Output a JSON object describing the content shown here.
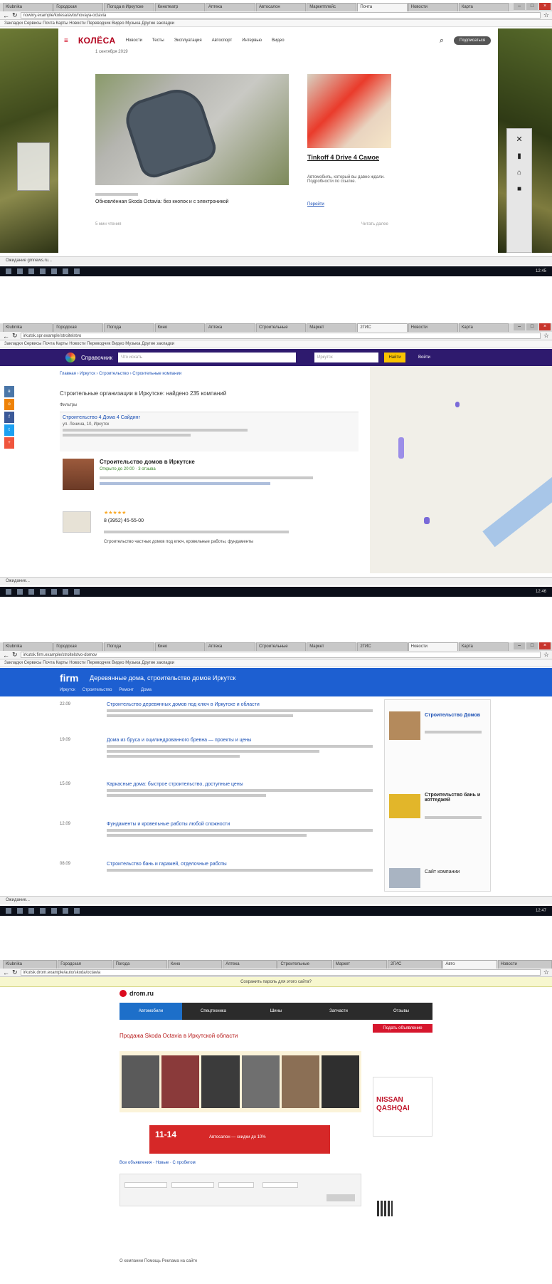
{
  "shots": [
    {
      "browser": {
        "tabs": [
          "Klubnika",
          "Городская",
          "Погода в Иркутске",
          "Кинотеатр",
          "Аптека",
          "Автосалон",
          "Маркетплейс",
          "Почта",
          "Новости",
          "Карта"
        ],
        "active_tab": 7,
        "url": "nowiny.example/kolesa/avto/novaya-octavia",
        "bookmarks": "Закладки   Сервисы   Почта   Карты   Новости   Переводчик   Видео   Музыка   Другие закладки"
      },
      "site": {
        "logo": "КОЛЁСА",
        "nav": [
          "Новости",
          "Тесты",
          "Эксплуатация",
          "Автоспорт",
          "Интервью",
          "Видео"
        ],
        "cta": "Подписаться",
        "date": "1 сентября 2019",
        "headline": "Обновлённая Skoda Octavia: без кнопок и с электроникой",
        "ad_title": "Tinkoff 4 Drive 4 Самое",
        "ad_text": "Автомобиль, который вы давно ждали. Подробности по ссылке.",
        "ad_link": "Перейти",
        "footer_left": "5 мин чтения",
        "footer_right": "Читать далее"
      },
      "rail_icons": [
        "vk-icon",
        "ok-icon",
        "fb-icon",
        "twitter-icon",
        "share-icon"
      ],
      "status": "Ожидание gmnews.ru...",
      "taskbar_time": "12:45"
    },
    {
      "browser": {
        "tabs": [
          "Klubnika",
          "Городская",
          "Погода",
          "Кино",
          "Аптека",
          "Строительные",
          "Маркет",
          "2ГИС",
          "Новости",
          "Карта"
        ],
        "active_tab": 7,
        "url": "irkutsk.spr.example/stroitelstvo",
        "bookmarks": "Закладки   Сервисы   Почта   Карты   Новости   Переводчик   Видео   Музыка   Другие закладки"
      },
      "site": {
        "logo": "Справочник",
        "search_placeholder": "Что искать",
        "city": "Иркутск",
        "search_button": "Найти",
        "login": "Войти",
        "breadcrumb": "Главная › Иркутск › Строительство › Строительные компании",
        "heading": "Строительные организации в Иркутске: найдено 235 компаний",
        "filters": "Фильтры",
        "card1_name": "Строительство 4 Дома 4 Сайдинг",
        "card1_addr": "ул. Ленина, 10, Иркутск",
        "card2_name": "Строительство домов в Иркутске",
        "card2_meta": "Открыто до 20:00 · 3 отзыва",
        "card3_rating": "★★★★★",
        "card3_phone": "8 (3952) 45-55-00",
        "card3_desc": "Строительство частных домов под ключ, кровельные работы, фундаменты"
      },
      "status": "Ожидание...",
      "taskbar_time": "12:46"
    },
    {
      "browser": {
        "tabs": [
          "Klubnika",
          "Городская",
          "Погода",
          "Кино",
          "Аптека",
          "Строительные",
          "Маркет",
          "2ГИС",
          "Новости",
          "Карта"
        ],
        "active_tab": 8,
        "url": "irkutsk.firm.example/stroitelstvo-domov",
        "bookmarks": "Закладки   Сервисы   Почта   Карты   Новости   Переводчик   Видео   Музыка   Другие закладки"
      },
      "site": {
        "logo": "firm",
        "title": "Деревянные дома, строительство домов Иркутск",
        "tabs": [
          "Иркутск",
          "Строительство",
          "Ремонт",
          "Дома"
        ],
        "entries": [
          {
            "date": "22.09",
            "title": "Строительство деревянных домов под ключ в Иркутске и области"
          },
          {
            "date": "19.09",
            "title": "Дома из бруса и оцилиндрованного бревна — проекты и цены"
          },
          {
            "date": "15.09",
            "title": "Каркасные дома: быстрое строительство, доступные цены"
          },
          {
            "date": "12.09",
            "title": "Фундаменты и кровельные работы любой сложности"
          },
          {
            "date": "08.09",
            "title": "Строительство бань и гаражей, отделочные работы"
          }
        ],
        "side_title1": "Строительство Домов",
        "side_title2": "Строительство бань и коттеджей",
        "side_title3": "Сайт компании"
      },
      "status": "Ожидание...",
      "taskbar_time": "12:47"
    },
    {
      "browser": {
        "tabs": [
          "Klubnika",
          "Городская",
          "Погода",
          "Кино",
          "Аптека",
          "Строительные",
          "Маркет",
          "2ГИС",
          "Авто",
          "Новости"
        ],
        "active_tab": 8,
        "url": "irkutsk.drom.example/auto/skoda/octavia",
        "notice": "Сохранить пароль для этого сайта?"
      },
      "site": {
        "logo": "drom.ru",
        "nav": [
          "Автомобили",
          "Спецтехника",
          "Шины",
          "Запчасти",
          "Отзывы"
        ],
        "heading": "Продажа Skoda Octavia в Иркутской области",
        "cta": "Подать объявление",
        "banner_num": "11-14",
        "banner_text": "Автосалон — скидки до 10%",
        "side_ad": "NISSAN QASHQAI",
        "links": "Все объявления · Новые · С пробегом",
        "footer": "О компании  Помощь  Реклама на сайте"
      }
    }
  ]
}
